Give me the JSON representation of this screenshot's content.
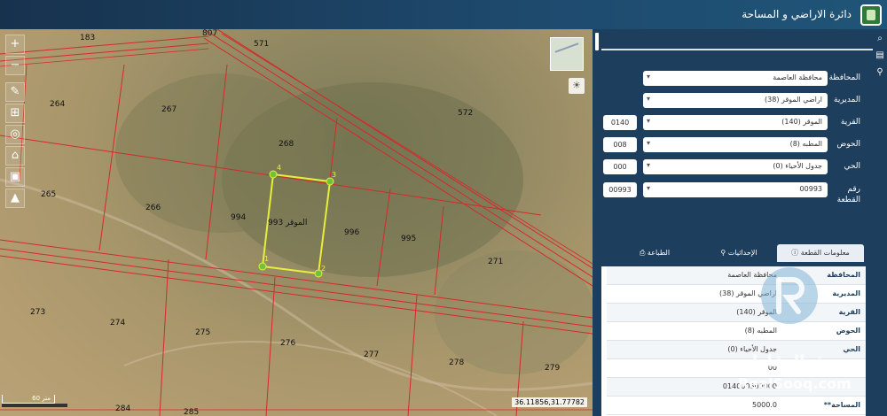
{
  "header": {
    "title": "دائرة الاراضي و المساحة"
  },
  "map": {
    "parcel_labels": [
      {
        "id": "p183",
        "text": "183"
      },
      {
        "id": "p807",
        "text": "807"
      },
      {
        "id": "p571",
        "text": "571"
      },
      {
        "id": "p264",
        "text": "264"
      },
      {
        "id": "p267",
        "text": "267"
      },
      {
        "id": "p572",
        "text": "572"
      },
      {
        "id": "p268",
        "text": "268"
      },
      {
        "id": "p265",
        "text": "265"
      },
      {
        "id": "p266",
        "text": "266"
      },
      {
        "id": "p994",
        "text": "994"
      },
      {
        "id": "p996",
        "text": "996"
      },
      {
        "id": "p995",
        "text": "995"
      },
      {
        "id": "p271",
        "text": "271"
      },
      {
        "id": "p273",
        "text": "273"
      },
      {
        "id": "p274",
        "text": "274"
      },
      {
        "id": "p275",
        "text": "275"
      },
      {
        "id": "p276",
        "text": "276"
      },
      {
        "id": "p277",
        "text": "277"
      },
      {
        "id": "p278",
        "text": "278"
      },
      {
        "id": "p279",
        "text": "279"
      },
      {
        "id": "p284",
        "text": "284"
      },
      {
        "id": "p285",
        "text": "285"
      }
    ],
    "selected_parcel_label": "الموقر 993",
    "vertex_labels": [
      "1",
      "2",
      "3",
      "4"
    ],
    "coordinates": "36.11856,31.77782",
    "scale_label": "60 متر",
    "tools": [
      "zoom-in",
      "zoom-out",
      "draw",
      "measure",
      "locate",
      "home",
      "export",
      "north"
    ]
  },
  "form": {
    "fields": [
      {
        "label": "المحافظة",
        "value": "محافظة العاصمة",
        "code": ""
      },
      {
        "label": "المديرية",
        "value": "اراضي الموقر (38)",
        "code": ""
      },
      {
        "label": "القرية",
        "value": "الموقر (140)",
        "code": "0140"
      },
      {
        "label": "الحوض",
        "value": "المطبه (8)",
        "code": "008"
      },
      {
        "label": "الحي",
        "value": "جدول الأحياء (0)",
        "code": "000"
      },
      {
        "label": "رقم القطعة",
        "value": "00993",
        "code": "00993"
      }
    ]
  },
  "tabs": {
    "info": "معلومات القطعة",
    "coords": "الإحداثيات",
    "print": "الطباعة"
  },
  "info": {
    "rows": [
      {
        "k": "المحافظة",
        "v": "محافظة العاصمة"
      },
      {
        "k": "المديرية",
        "v": "اراضي الموقر (38)"
      },
      {
        "k": "القرية",
        "v": "الموقر (140)"
      },
      {
        "k": "الحوض",
        "v": "المطبه (8)"
      },
      {
        "k": "الحي",
        "v": "جدول الأحياء (0)"
      },
      {
        "k": "",
        "v": "00"
      },
      {
        "k": "",
        "v": "014000800000"
      },
      {
        "k": "المساحة**",
        "v": "5000.0"
      }
    ]
  },
  "watermark": {
    "ar": "سوق العقارات",
    "en": "RealSooq.com"
  },
  "colors": {
    "panel": "#1d3e5c",
    "parcel_lines": "#d42a2a",
    "selected": "#e6ef3a"
  }
}
